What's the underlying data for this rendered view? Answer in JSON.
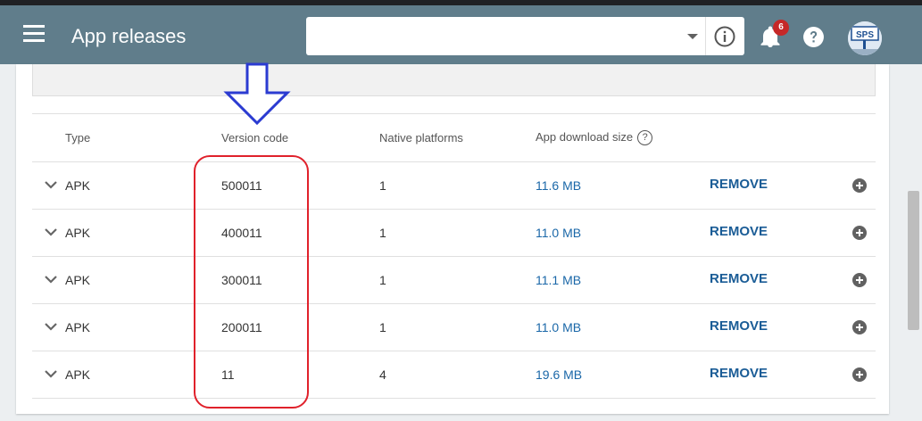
{
  "header": {
    "title": "App releases",
    "search_placeholder": "",
    "notifications_count": "6",
    "avatar_text": "SPS"
  },
  "table": {
    "columns": {
      "type": "Type",
      "version_code": "Version code",
      "native_platforms": "Native platforms",
      "download_size": "App download size",
      "help": "?"
    },
    "remove_label": "REMOVE",
    "rows": [
      {
        "type": "APK",
        "version_code": "500011",
        "native_platforms": "1",
        "size": "11.6 MB"
      },
      {
        "type": "APK",
        "version_code": "400011",
        "native_platforms": "1",
        "size": "11.0 MB"
      },
      {
        "type": "APK",
        "version_code": "300011",
        "native_platforms": "1",
        "size": "11.1 MB"
      },
      {
        "type": "APK",
        "version_code": "200011",
        "native_platforms": "1",
        "size": "11.0 MB"
      },
      {
        "type": "APK",
        "version_code": "11",
        "native_platforms": "4",
        "size": "19.6 MB"
      }
    ]
  },
  "colors": {
    "appbar": "#607d8b",
    "link": "#1a67a8",
    "annotation_arrow": "#2b3bd1",
    "annotation_box": "#e0212b",
    "badge": "#c62828"
  },
  "icons": [
    "menu-icon",
    "chevron-down-icon",
    "info-icon",
    "bell-icon",
    "help-icon",
    "expand-chevron-icon",
    "add-circle-icon"
  ]
}
